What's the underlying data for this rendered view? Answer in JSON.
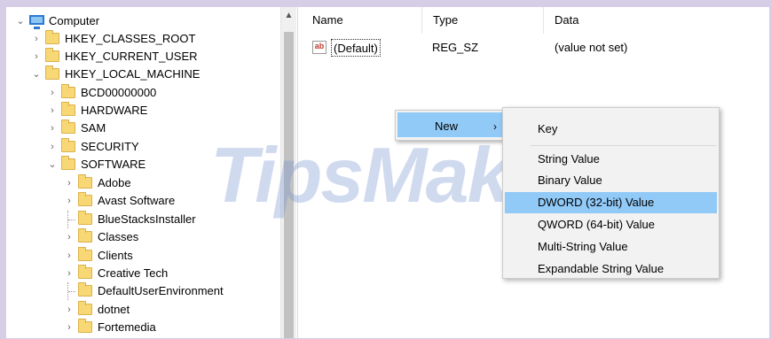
{
  "tree": {
    "root": "Computer",
    "items": [
      {
        "label": "HKEY_CLASSES_ROOT"
      },
      {
        "label": "HKEY_CURRENT_USER"
      },
      {
        "label": "HKEY_LOCAL_MACHINE"
      },
      {
        "label": "BCD00000000"
      },
      {
        "label": "HARDWARE"
      },
      {
        "label": "SAM"
      },
      {
        "label": "SECURITY"
      },
      {
        "label": "SOFTWARE"
      },
      {
        "label": "Adobe"
      },
      {
        "label": "Avast Software"
      },
      {
        "label": "BlueStacksInstaller"
      },
      {
        "label": "Classes"
      },
      {
        "label": "Clients"
      },
      {
        "label": "Creative Tech"
      },
      {
        "label": "DefaultUserEnvironment"
      },
      {
        "label": "dotnet"
      },
      {
        "label": "Fortemedia"
      }
    ]
  },
  "list": {
    "columns": {
      "name": "Name",
      "type": "Type",
      "data": "Data"
    },
    "rows": [
      {
        "name": "(Default)",
        "type": "REG_SZ",
        "data": "(value not set)",
        "icon": "ab"
      }
    ]
  },
  "context_menu": {
    "new_label": "New"
  },
  "submenu": {
    "items": [
      {
        "label": "Key"
      },
      {
        "label": "String Value"
      },
      {
        "label": "Binary Value"
      },
      {
        "label": "DWORD (32-bit) Value"
      },
      {
        "label": "QWORD (64-bit) Value"
      },
      {
        "label": "Multi-String Value"
      },
      {
        "label": "Expandable String Value"
      }
    ]
  },
  "watermark": "TipsMake",
  "colors": {
    "highlight": "#91c9f7",
    "folder": "#f8d775",
    "background": "#d6cde6"
  }
}
